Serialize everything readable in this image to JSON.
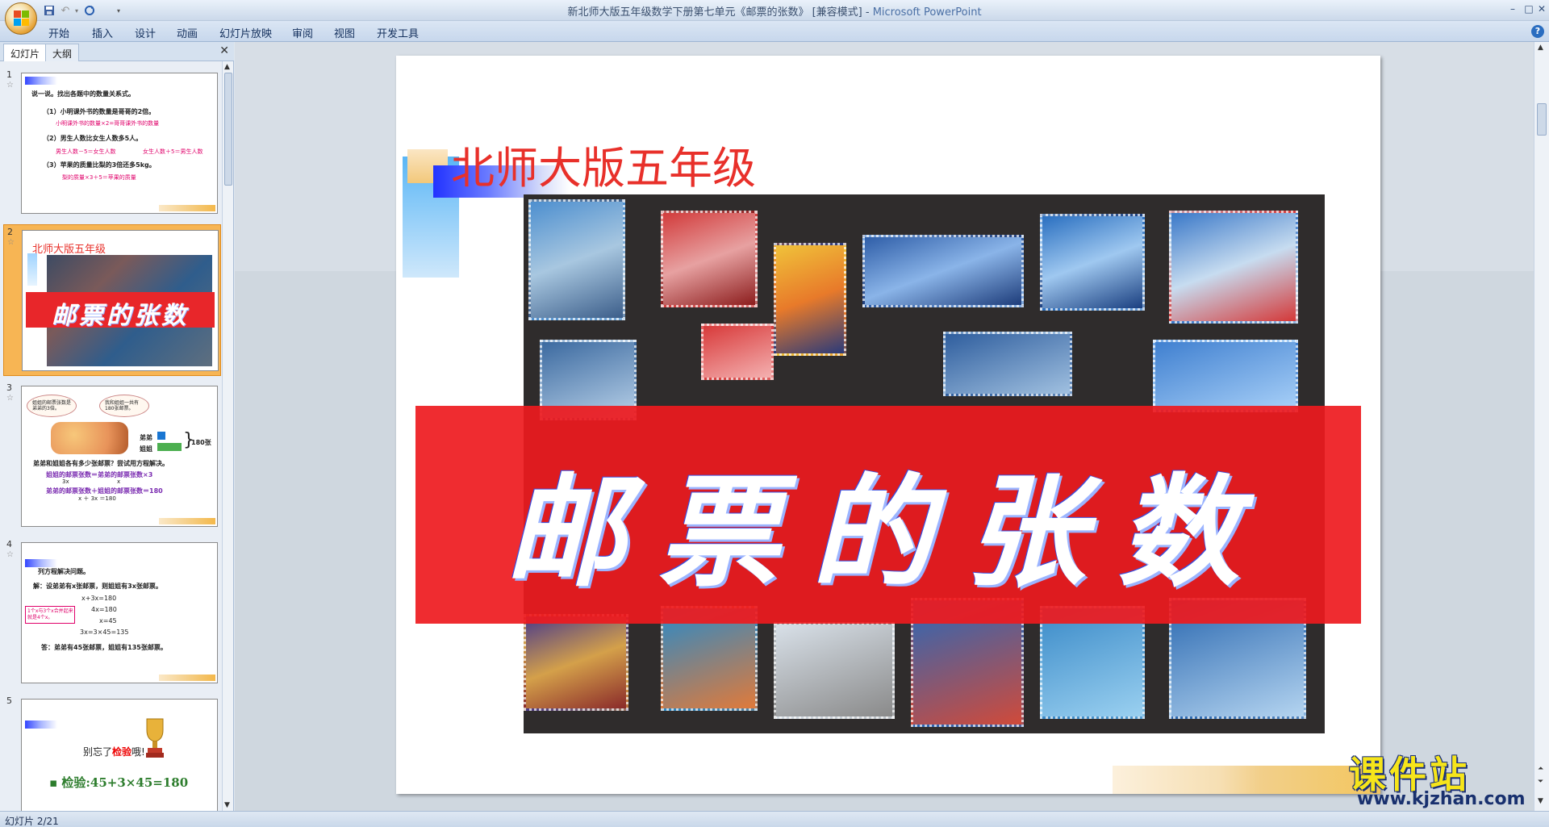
{
  "window": {
    "title_doc": "新北师大版五年级数学下册第七单元《邮票的张数》 [兼容模式] -",
    "title_app": "Microsoft PowerPoint",
    "minimize": "–",
    "maximize": "□",
    "close": "✕"
  },
  "ribbon": {
    "tabs": [
      "开始",
      "插入",
      "设计",
      "动画",
      "幻灯片放映",
      "审阅",
      "视图",
      "开发工具"
    ],
    "help": "?"
  },
  "pane": {
    "tab_slides": "幻灯片",
    "tab_outline": "大纲",
    "close": "✕"
  },
  "thumbnails": [
    {
      "num": "1",
      "lines": [
        "说一说。找出各题中的数量关系式。",
        "（1）小明课外书的数量是哥哥的2倍。",
        "小明课外书的数量×2=哥哥课外书的数量",
        "（2）男生人数比女生人数多5人。",
        "男生人数－5＝女生人数",
        "女生人数＋5＝男生人数",
        "（3）苹果的质量比梨的3倍还多5kg。",
        "梨的质量×3＋5＝苹果的质量"
      ]
    },
    {
      "num": "2",
      "title": "北师大版五年级",
      "banner": "邮票的张数"
    },
    {
      "num": "3",
      "bubble1": "姐姐的邮票张数是弟弟的3倍。",
      "bubble2": "我和姐姐一共有180张邮票。",
      "label_brother": "弟弟",
      "label_sister": "姐姐",
      "total": "180张",
      "lines": [
        "弟弟和姐姐各有多少张邮票？尝试用方程解决。",
        "姐姐的邮票张数＝弟弟的邮票张数×3",
        "3x",
        "x",
        "弟弟的邮票张数＋姐姐的邮票张数＝180",
        "x ＋ 3x ＝180"
      ]
    },
    {
      "num": "4",
      "lines": [
        "列方程解决问题。",
        "解：设弟弟有x张邮票，则姐姐有3x张邮票。",
        "x+3x=180",
        "4x=180",
        "x=45",
        "3x=3×45=135",
        "答：弟弟有45张邮票，姐姐有135张邮票。"
      ],
      "note": "1个x与3个x合并起来就是4个x。"
    },
    {
      "num": "5",
      "text_before": "别忘了",
      "text_highlight": "检验",
      "text_after": "哦!",
      "check": "检验:45+3×45=180"
    }
  ],
  "slide": {
    "title": "北师大版五年级",
    "banner": "邮票的张数"
  },
  "status": {
    "text": "幻灯片 2/21"
  },
  "watermark": {
    "cn": "课件站",
    "url": "www.kjzhan.com"
  },
  "colors": {
    "title_red": "#e8302a",
    "banner_red": "#ee1a1e",
    "selected_slot": "#f7b554",
    "watermark_yellow": "#f6e51a"
  }
}
